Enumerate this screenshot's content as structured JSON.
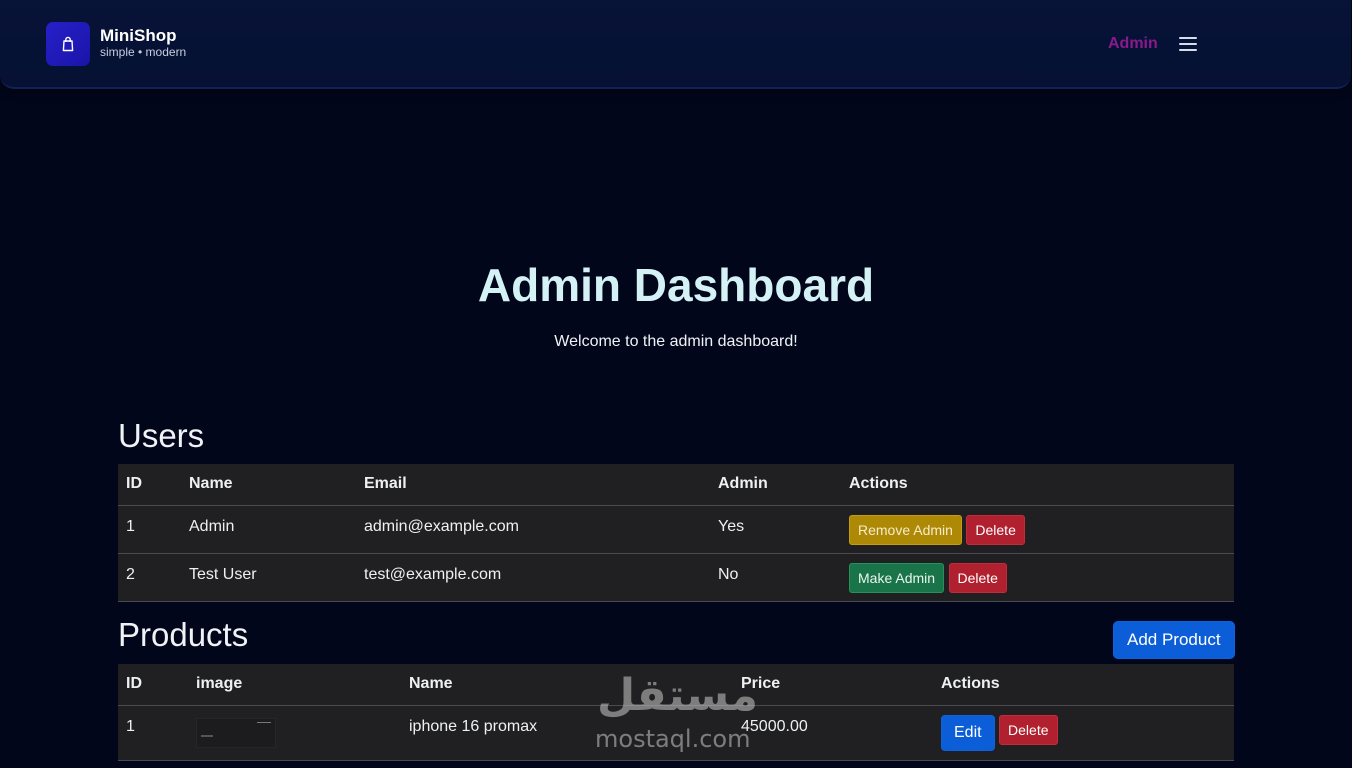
{
  "header": {
    "brand_name": "MiniShop",
    "brand_tagline": "simple • modern",
    "nav_admin_label": "Admin",
    "logo_icon": "shopping-bag-icon",
    "menu_icon": "hamburger-menu-icon"
  },
  "hero": {
    "title": "Admin Dashboard",
    "subtitle": "Welcome to the admin dashboard!"
  },
  "users": {
    "title": "Users",
    "columns": [
      "ID",
      "Name",
      "Email",
      "Admin",
      "Actions"
    ],
    "rows": [
      {
        "id": "1",
        "name": "Admin",
        "email": "admin@example.com",
        "admin": "Yes",
        "toggle_label": "Remove Admin",
        "delete_label": "Delete"
      },
      {
        "id": "2",
        "name": "Test User",
        "email": "test@example.com",
        "admin": "No",
        "toggle_label": "Make Admin",
        "delete_label": "Delete"
      }
    ]
  },
  "products": {
    "title": "Products",
    "add_label": "Add Product",
    "columns": [
      "ID",
      "image",
      "Name",
      "Price",
      "Actions"
    ],
    "rows": [
      {
        "id": "1",
        "name": "iphone 16 promax",
        "price": "45000.00",
        "edit_label": "Edit",
        "delete_label": "Delete"
      }
    ]
  },
  "watermark": {
    "arabic": "مستقل",
    "latin": "mostaql.com"
  },
  "colors": {
    "background": "#02061a",
    "navbar": "#071337",
    "accent_admin_link": "#8a1a8c",
    "warning": "#ad8906",
    "danger": "#b0202f",
    "success": "#19744a",
    "primary": "#0b5ed7"
  }
}
